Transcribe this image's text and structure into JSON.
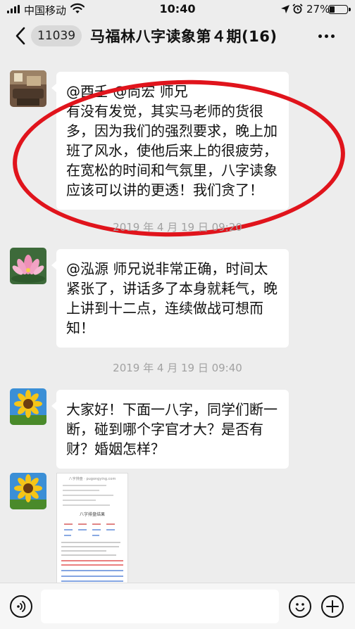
{
  "status_bar": {
    "carrier": "中国移动",
    "time": "10:40",
    "battery_percent_text": "27%",
    "battery_level": 0.27,
    "icons": [
      "signal-icon",
      "wifi-icon",
      "location-icon",
      "alarm-icon",
      "battery-icon"
    ]
  },
  "nav": {
    "back_icon": "chevron-left-icon",
    "unread_count": "11039",
    "title": "马福林八字读象第４期(16)",
    "more_icon": "more-icon"
  },
  "messages": [
    {
      "type": "text",
      "avatar": "avatar-room",
      "lines": [
        "@酉壬 @尚宏  师兄",
        "有没有发觉，其实马老师的货很",
        "多，因为我们的强烈要求，晚上加",
        "班了风水，使他后来上的很疲劳，",
        "在宽松的时间和气氛里，八字读象",
        "应该可以讲的更透！我们贪了！"
      ]
    },
    {
      "type": "timestamp",
      "text": "2019 年 4 月 19 日  09:20"
    },
    {
      "type": "text",
      "avatar": "avatar-lotus",
      "lines": [
        "@泓源 师兄说非常正确，时间太",
        "紧张了，讲话多了本身就耗气，晚",
        "上讲到十二点，连续做战可想而",
        "知！"
      ]
    },
    {
      "type": "timestamp",
      "text": "2019 年 4 月 19 日  09:40"
    },
    {
      "type": "text",
      "avatar": "avatar-sunflower",
      "lines": [
        "大家好！下面一八字，同学们断一",
        "断，碰到哪个字官才大？是否有",
        "财？婚姻怎样？"
      ]
    },
    {
      "type": "image",
      "avatar": "avatar-sunflower",
      "thumb_url_text": "八字排盘 · pugongying.com",
      "thumb_title": "八字排盘结果"
    }
  ],
  "input_bar": {
    "voice_icon": "voice-icon",
    "placeholder": "",
    "emoji_icon": "emoji-icon",
    "plus_icon": "plus-icon"
  },
  "colors": {
    "background": "#ededed",
    "bubble": "#ffffff",
    "annotation_circle": "#e0141c",
    "timestamp_text": "#a2a2a2"
  }
}
